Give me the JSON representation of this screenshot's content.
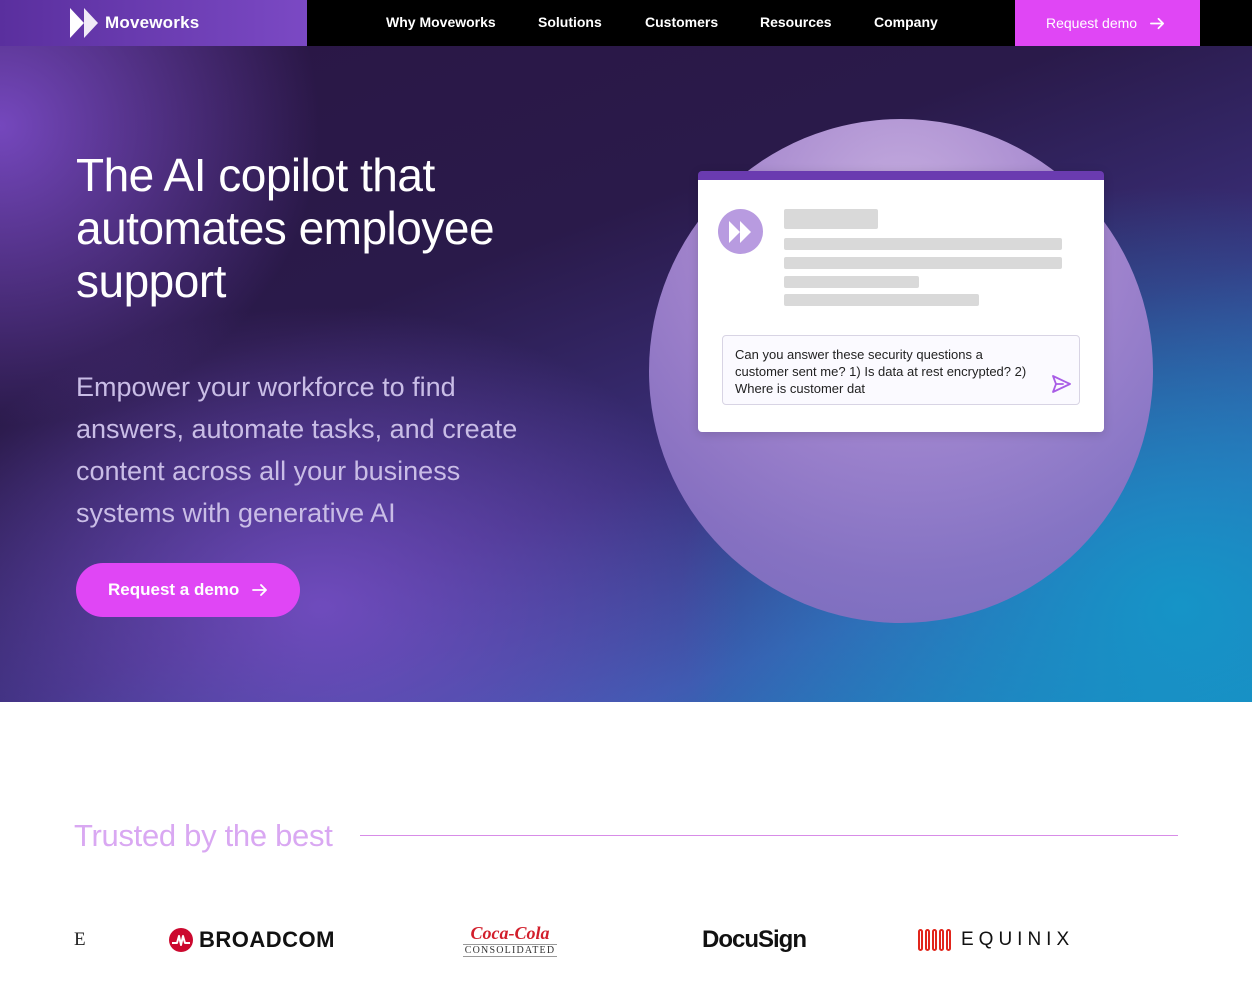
{
  "nav": {
    "brand": "Moveworks",
    "links": [
      "Why Moveworks",
      "Solutions",
      "Customers",
      "Resources",
      "Company"
    ],
    "cta_label": "Request demo"
  },
  "hero": {
    "title": "The AI copilot that automates employee support",
    "subtitle": "Empower your workforce to find answers, automate tasks, and create content across all your business systems with generative AI",
    "cta_label": "Request a demo",
    "chat_input_text": "Can you answer these security questions a customer sent me? 1) Is data at rest encrypted? 2) Where is customer dat"
  },
  "trusted": {
    "heading": "Trusted by the best",
    "logos": {
      "partial": "E",
      "broadcom": "BROADCOM",
      "coke_script": "Coca-Cola",
      "coke_sub": "CONSOLIDATED",
      "docusign": "DocuSign",
      "equinix": "EQUINIX"
    }
  },
  "colors": {
    "accent": "#e046f5",
    "brand_purple": "#6a3bb0",
    "trusted_heading": "#d9a8f2"
  }
}
